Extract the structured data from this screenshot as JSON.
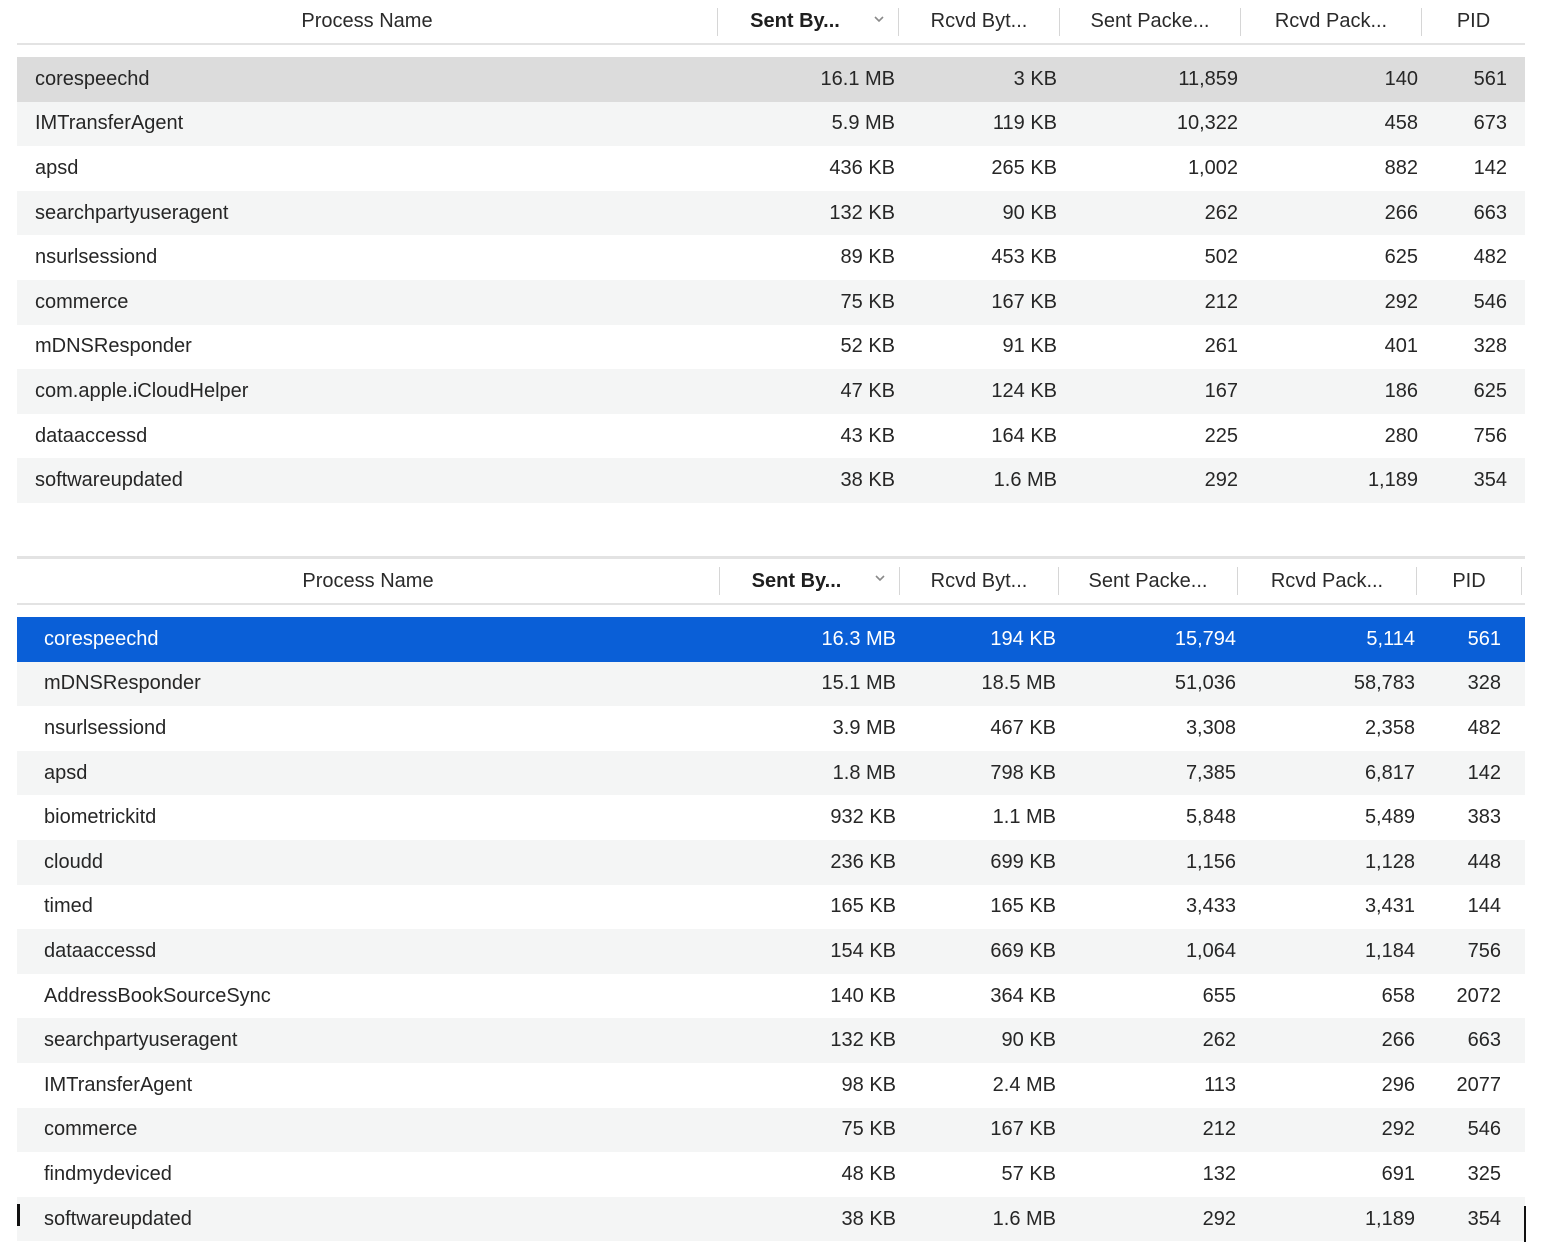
{
  "top_table": {
    "columns": [
      {
        "label": "Process Name",
        "sorted": false
      },
      {
        "label": "Sent By...",
        "sorted": true
      },
      {
        "label": "Rcvd Byt...",
        "sorted": false
      },
      {
        "label": "Sent Packe...",
        "sorted": false
      },
      {
        "label": "Rcvd Pack...",
        "sorted": false
      },
      {
        "label": "PID",
        "sorted": false
      }
    ],
    "rows": [
      {
        "name": "corespeechd",
        "sent_bytes": "16.1 MB",
        "rcvd_bytes": "3 KB",
        "sent_packets": "11,859",
        "rcvd_packets": "140",
        "pid": "561",
        "selected": true
      },
      {
        "name": "IMTransferAgent",
        "sent_bytes": "5.9 MB",
        "rcvd_bytes": "119 KB",
        "sent_packets": "10,322",
        "rcvd_packets": "458",
        "pid": "673"
      },
      {
        "name": "apsd",
        "sent_bytes": "436 KB",
        "rcvd_bytes": "265 KB",
        "sent_packets": "1,002",
        "rcvd_packets": "882",
        "pid": "142"
      },
      {
        "name": "searchpartyuseragent",
        "sent_bytes": "132 KB",
        "rcvd_bytes": "90 KB",
        "sent_packets": "262",
        "rcvd_packets": "266",
        "pid": "663"
      },
      {
        "name": "nsurlsessiond",
        "sent_bytes": "89 KB",
        "rcvd_bytes": "453 KB",
        "sent_packets": "502",
        "rcvd_packets": "625",
        "pid": "482"
      },
      {
        "name": "commerce",
        "sent_bytes": "75 KB",
        "rcvd_bytes": "167 KB",
        "sent_packets": "212",
        "rcvd_packets": "292",
        "pid": "546"
      },
      {
        "name": "mDNSResponder",
        "sent_bytes": "52 KB",
        "rcvd_bytes": "91 KB",
        "sent_packets": "261",
        "rcvd_packets": "401",
        "pid": "328"
      },
      {
        "name": "com.apple.iCloudHelper",
        "sent_bytes": "47 KB",
        "rcvd_bytes": "124 KB",
        "sent_packets": "167",
        "rcvd_packets": "186",
        "pid": "625"
      },
      {
        "name": "dataaccessd",
        "sent_bytes": "43 KB",
        "rcvd_bytes": "164 KB",
        "sent_packets": "225",
        "rcvd_packets": "280",
        "pid": "756"
      },
      {
        "name": "softwareupdated",
        "sent_bytes": "38 KB",
        "rcvd_bytes": "1.6 MB",
        "sent_packets": "292",
        "rcvd_packets": "1,189",
        "pid": "354"
      }
    ]
  },
  "bottom_table": {
    "columns": [
      {
        "label": "Process Name",
        "sorted": false
      },
      {
        "label": "Sent By...",
        "sorted": true
      },
      {
        "label": "Rcvd Byt...",
        "sorted": false
      },
      {
        "label": "Sent Packe...",
        "sorted": false
      },
      {
        "label": "Rcvd Pack...",
        "sorted": false
      },
      {
        "label": "PID",
        "sorted": false
      }
    ],
    "rows": [
      {
        "name": "corespeechd",
        "sent_bytes": "16.3 MB",
        "rcvd_bytes": "194 KB",
        "sent_packets": "15,794",
        "rcvd_packets": "5,114",
        "pid": "561",
        "selected": true
      },
      {
        "name": "mDNSResponder",
        "sent_bytes": "15.1 MB",
        "rcvd_bytes": "18.5 MB",
        "sent_packets": "51,036",
        "rcvd_packets": "58,783",
        "pid": "328"
      },
      {
        "name": "nsurlsessiond",
        "sent_bytes": "3.9 MB",
        "rcvd_bytes": "467 KB",
        "sent_packets": "3,308",
        "rcvd_packets": "2,358",
        "pid": "482"
      },
      {
        "name": "apsd",
        "sent_bytes": "1.8 MB",
        "rcvd_bytes": "798 KB",
        "sent_packets": "7,385",
        "rcvd_packets": "6,817",
        "pid": "142"
      },
      {
        "name": "biometrickitd",
        "sent_bytes": "932 KB",
        "rcvd_bytes": "1.1 MB",
        "sent_packets": "5,848",
        "rcvd_packets": "5,489",
        "pid": "383"
      },
      {
        "name": "cloudd",
        "sent_bytes": "236 KB",
        "rcvd_bytes": "699 KB",
        "sent_packets": "1,156",
        "rcvd_packets": "1,128",
        "pid": "448"
      },
      {
        "name": "timed",
        "sent_bytes": "165 KB",
        "rcvd_bytes": "165 KB",
        "sent_packets": "3,433",
        "rcvd_packets": "3,431",
        "pid": "144"
      },
      {
        "name": "dataaccessd",
        "sent_bytes": "154 KB",
        "rcvd_bytes": "669 KB",
        "sent_packets": "1,064",
        "rcvd_packets": "1,184",
        "pid": "756"
      },
      {
        "name": "AddressBookSourceSync",
        "sent_bytes": "140 KB",
        "rcvd_bytes": "364 KB",
        "sent_packets": "655",
        "rcvd_packets": "658",
        "pid": "2072"
      },
      {
        "name": "searchpartyuseragent",
        "sent_bytes": "132 KB",
        "rcvd_bytes": "90 KB",
        "sent_packets": "262",
        "rcvd_packets": "266",
        "pid": "663"
      },
      {
        "name": "IMTransferAgent",
        "sent_bytes": "98 KB",
        "rcvd_bytes": "2.4 MB",
        "sent_packets": "113",
        "rcvd_packets": "296",
        "pid": "2077"
      },
      {
        "name": "commerce",
        "sent_bytes": "75 KB",
        "rcvd_bytes": "167 KB",
        "sent_packets": "212",
        "rcvd_packets": "292",
        "pid": "546"
      },
      {
        "name": "findmydeviced",
        "sent_bytes": "48 KB",
        "rcvd_bytes": "57 KB",
        "sent_packets": "132",
        "rcvd_packets": "691",
        "pid": "325"
      },
      {
        "name": "softwareupdated",
        "sent_bytes": "38 KB",
        "rcvd_bytes": "1.6 MB",
        "sent_packets": "292",
        "rcvd_packets": "1,189",
        "pid": "354"
      }
    ]
  },
  "colors": {
    "selection_blue": "#0a5fd7",
    "selection_gray": "#dcdcdc",
    "alt_row": "#f4f5f5"
  },
  "icons": {
    "sort_indicator": "chevron-down-icon"
  }
}
